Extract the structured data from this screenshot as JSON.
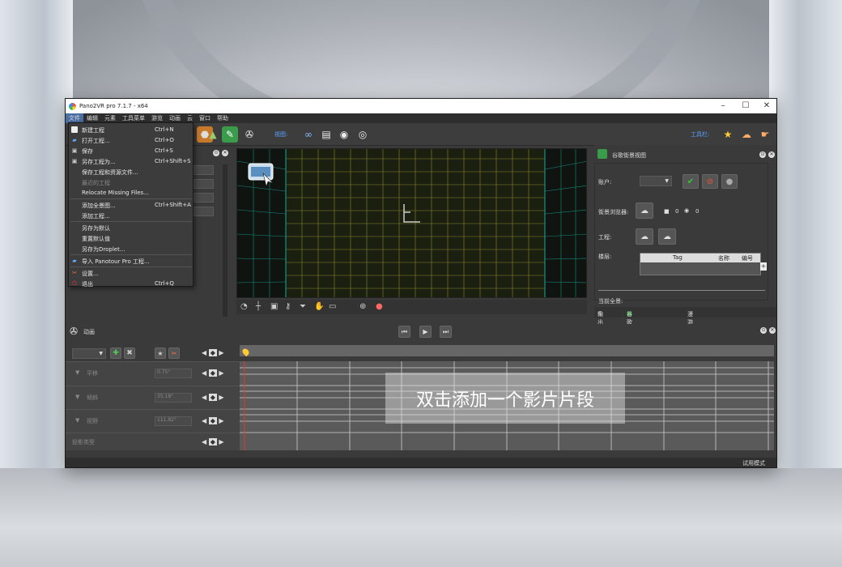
{
  "window": {
    "title": "Pano2VR pro 7.1.7 - x64",
    "status_text": "试用模式"
  },
  "menubar": [
    "文件",
    "编辑",
    "元素",
    "工具菜单",
    "游览",
    "动画",
    "云",
    "窗口",
    "帮助"
  ],
  "file_menu": [
    {
      "label": "新建工程",
      "shortcut": "Ctrl+N",
      "icon": "new-file-icon"
    },
    {
      "label": "打开工程...",
      "shortcut": "Ctrl+O",
      "icon": "open-folder-icon"
    },
    {
      "label": "保存",
      "shortcut": "Ctrl+S",
      "icon": "save-icon"
    },
    {
      "label": "另存工程为...",
      "shortcut": "Ctrl+Shift+S",
      "icon": "save-as-icon"
    },
    {
      "label": "保存工程和资源文件...",
      "shortcut": "",
      "icon": ""
    },
    {
      "label": "最近的工程",
      "shortcut": "",
      "icon": "",
      "disabled": true
    },
    {
      "label": "Relocate Missing Files...",
      "shortcut": "",
      "icon": ""
    },
    {
      "label": "添加全景图...",
      "shortcut": "Ctrl+Shift+A",
      "icon": ""
    },
    {
      "label": "添加工程...",
      "shortcut": "",
      "icon": ""
    },
    {
      "label": "另存为默认",
      "shortcut": "",
      "icon": ""
    },
    {
      "label": "重置默认值",
      "shortcut": "",
      "icon": ""
    },
    {
      "label": "另存为Droplet...",
      "shortcut": "",
      "icon": ""
    },
    {
      "label": "导入 Panotour Pro 工程...",
      "shortcut": "",
      "icon": "import-icon"
    },
    {
      "label": "设置...",
      "shortcut": "",
      "icon": "settings-icon"
    },
    {
      "label": "退出",
      "shortcut": "Ctrl+Q",
      "icon": "power-icon"
    }
  ],
  "toolbar": {
    "view_label": "视图:",
    "tools_label": "工具栏:"
  },
  "google_panel": {
    "title": "谷歌街景视图",
    "account_label": "账户:",
    "browser_label": "街景浏览器:",
    "photo_count": "0",
    "view_count": "0",
    "project_label": "工程:",
    "floor_label": "楼层:",
    "table_headers": [
      "Tag",
      "名称",
      "编号"
    ],
    "current_pano_label": "当前全景:"
  },
  "bottom_tabs": [
    "输出",
    "谷歌街景视图",
    "漫游地图"
  ],
  "animation": {
    "title": "动画",
    "tracks": [
      {
        "label": "平移",
        "value": "0.75°"
      },
      {
        "label": "倾斜",
        "value": "35.18°"
      },
      {
        "label": "视野",
        "value": "111.82°"
      }
    ],
    "bottom_track_label": "投影类型",
    "empty_hint": "双击添加一个影片片段"
  },
  "colors": {
    "accent": "#4a6fa5",
    "blue_text": "#5aa0ff",
    "grid_yellow": "#8a8a2a",
    "grid_cyan": "#1aa89a"
  }
}
